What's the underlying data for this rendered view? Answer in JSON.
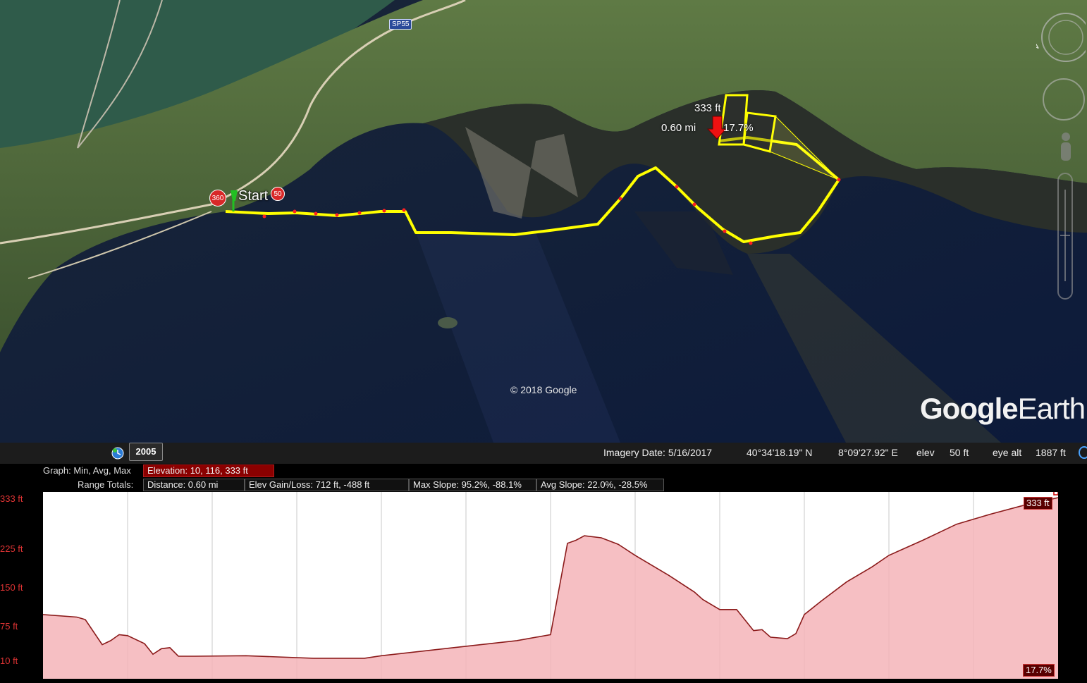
{
  "map": {
    "road_label": "SP55",
    "copyright": "© 2018 Google",
    "logo_bold": "Google",
    "logo_thin": "Earth",
    "start_label": "Start",
    "badge_left": "360",
    "badge_right": "50",
    "marker_elevation": "333 ft",
    "marker_distance": "0.60 mi",
    "marker_slope": "17.7%"
  },
  "statusbar": {
    "year": "2005",
    "imagery_date": "Imagery Date: 5/16/2017",
    "latitude": "40°34'18.19\" N",
    "longitude": "8°09'27.92\" E",
    "elev_label": "elev",
    "elev_value": "50 ft",
    "eye_alt_label": "eye alt",
    "eye_alt_value": "1887 ft"
  },
  "profile": {
    "graph_label": "Graph: Min, Avg, Max",
    "elevation_stat": "Elevation: 10, 116, 333 ft",
    "range_label": "Range Totals:",
    "distance_stat": "Distance: 0.60 mi",
    "gain_loss_stat": "Elev Gain/Loss: 712 ft, -488 ft",
    "max_slope_stat": "Max Slope: 95.2%, -88.1%",
    "avg_slope_stat": "Avg Slope: 22.0%, -28.5%",
    "y_ticks": [
      "333 ft",
      "225 ft",
      "150 ft",
      "75 ft",
      "10 ft"
    ],
    "end_elevation": "333 ft",
    "end_slope": "17.7%"
  },
  "chart_data": {
    "type": "area",
    "title": "",
    "xlabel": "",
    "ylabel": "",
    "ylim": [
      10,
      333
    ],
    "xlim": [
      0,
      0.6
    ],
    "x": [
      0,
      0.02,
      0.025,
      0.035,
      0.04,
      0.045,
      0.05,
      0.06,
      0.065,
      0.07,
      0.075,
      0.08,
      0.09,
      0.12,
      0.16,
      0.19,
      0.2,
      0.24,
      0.28,
      0.3,
      0.31,
      0.315,
      0.32,
      0.33,
      0.34,
      0.35,
      0.37,
      0.385,
      0.39,
      0.4,
      0.41,
      0.42,
      0.425,
      0.43,
      0.44,
      0.445,
      0.45,
      0.46,
      0.475,
      0.49,
      0.5,
      0.52,
      0.54,
      0.56,
      0.58,
      0.6
    ],
    "series": [
      {
        "values": [
          100,
          95,
          90,
          40,
          48,
          60,
          58,
          42,
          21,
          32,
          34,
          17,
          17,
          18,
          13,
          13,
          18,
          33,
          48,
          60,
          242,
          248,
          257,
          253,
          240,
          218,
          178,
          145,
          130,
          110,
          110,
          68,
          70,
          55,
          52,
          62,
          100,
          127,
          165,
          195,
          218,
          248,
          280,
          300,
          318,
          333
        ]
      }
    ]
  }
}
